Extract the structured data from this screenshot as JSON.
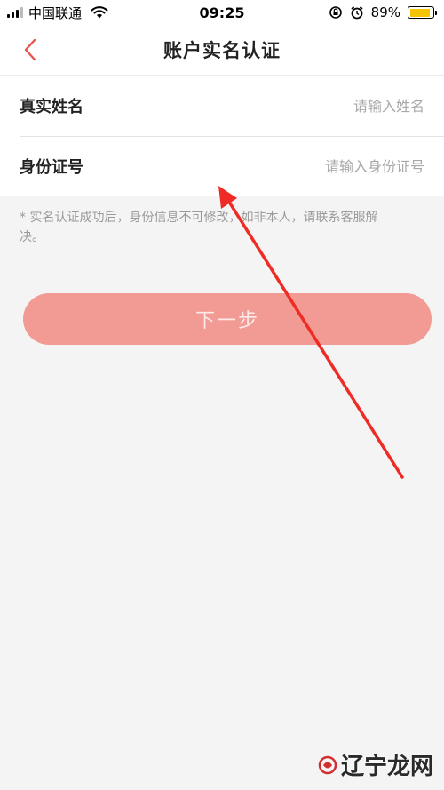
{
  "status_bar": {
    "carrier": "中国联通",
    "time": "09:25",
    "battery": "89%",
    "battery_level": 0.89
  },
  "nav": {
    "title": "账户实名认证",
    "back_icon": "chevron-left-icon"
  },
  "form": {
    "name_label": "真实姓名",
    "name_placeholder": "请输入姓名",
    "id_label": "身份证号",
    "id_placeholder": "请输入身份证号"
  },
  "notice": "* 实名认证成功后，身份信息不可修改，如非本人，请联系客服解决。",
  "next_button": "下一步",
  "watermark": "辽宁龙网",
  "colors": {
    "accent": "#e8554c",
    "button": "#f29a94",
    "annotation": "#ee2b24"
  }
}
